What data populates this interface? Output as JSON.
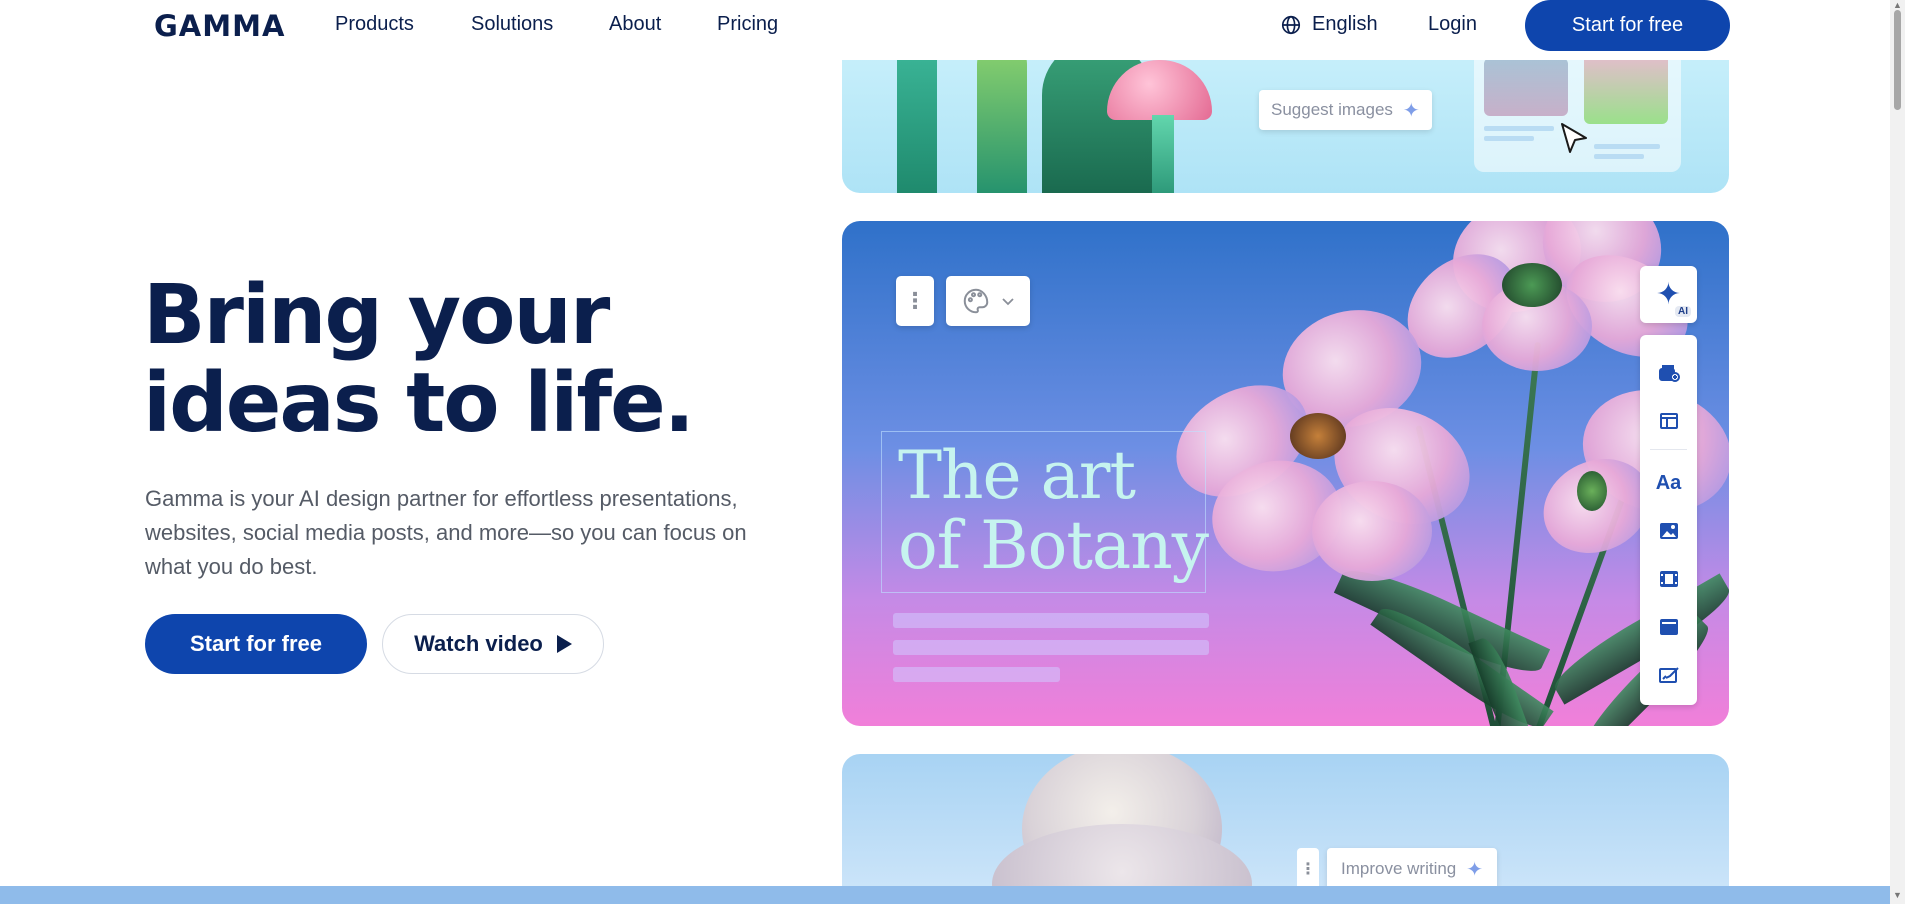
{
  "nav": {
    "logo": "GAMMA",
    "links": [
      "Products",
      "Solutions",
      "About",
      "Pricing"
    ],
    "language": "English",
    "login": "Login",
    "cta": "Start for free"
  },
  "hero": {
    "title_line1": "Bring your",
    "title_line2": "ideas to life.",
    "subtitle": "Gamma is your AI design partner for effortless presentations, websites, social media posts, and more—so you can focus on what you do best.",
    "primary_cta": "Start for free",
    "secondary_cta": "Watch video"
  },
  "cards": {
    "top": {
      "suggest_label": "Suggest images"
    },
    "main": {
      "title": "The art\nof Botany",
      "ai_badge": "AI",
      "tools": [
        "add-card-icon",
        "layout-icon",
        "text-icon",
        "image-icon",
        "video-icon",
        "embed-icon",
        "edit-icon"
      ]
    },
    "bottom": {
      "improve_label": "Improve writing"
    }
  },
  "colors": {
    "brand": "#0e45ad",
    "text_dark": "#0b1f4d",
    "text_muted": "#555b66"
  }
}
